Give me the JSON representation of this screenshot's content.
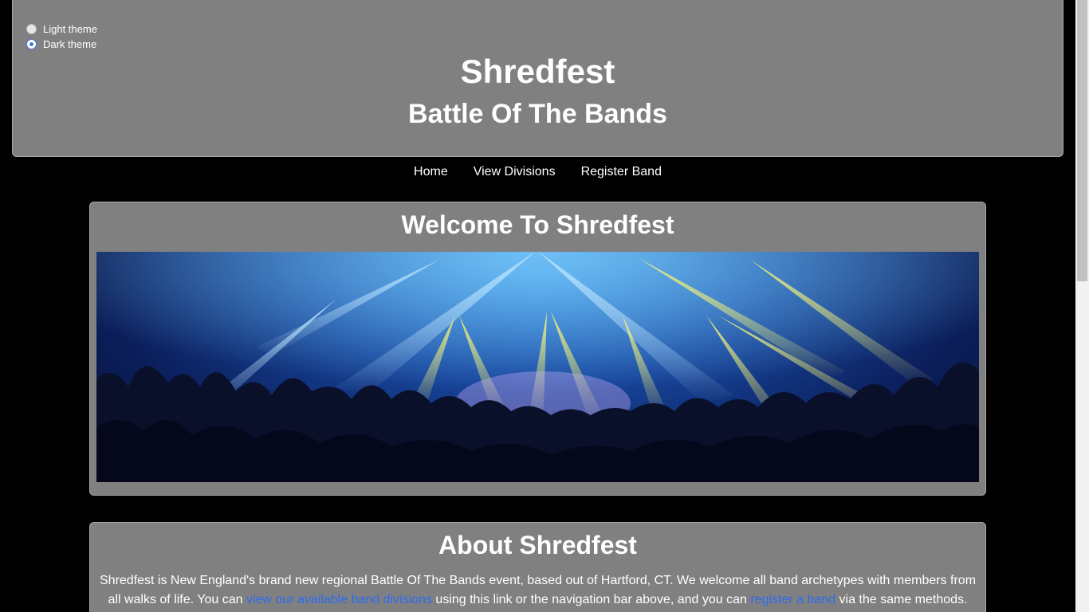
{
  "theme": {
    "options": [
      {
        "label": "Light theme",
        "checked": false
      },
      {
        "label": "Dark theme",
        "checked": true
      }
    ]
  },
  "header": {
    "title": "Shredfest",
    "subtitle": "Battle Of The Bands"
  },
  "nav": {
    "home": "Home",
    "divisions": "View Divisions",
    "register": "Register Band"
  },
  "welcome": {
    "heading": "Welcome To Shredfest",
    "image_alt": "concert-crowd-stage-lights"
  },
  "about": {
    "heading": "About Shredfest",
    "text_1": "Shredfest is New England's brand new regional Battle Of The Bands event, based out of Hartford, CT. We welcome all band archetypes with members from all walks of life. You can ",
    "link_1": "view our available band divisions",
    "text_2": " using this link or the navigation bar above, and you can ",
    "link_2": "register a band",
    "text_3": " via the same methods. We hope you join us, be it as a competitor or just to take in some of the region's best up-and-coming acts!"
  },
  "colors": {
    "background": "#000000",
    "panel": "#808080",
    "link": "#2b6cf0"
  }
}
